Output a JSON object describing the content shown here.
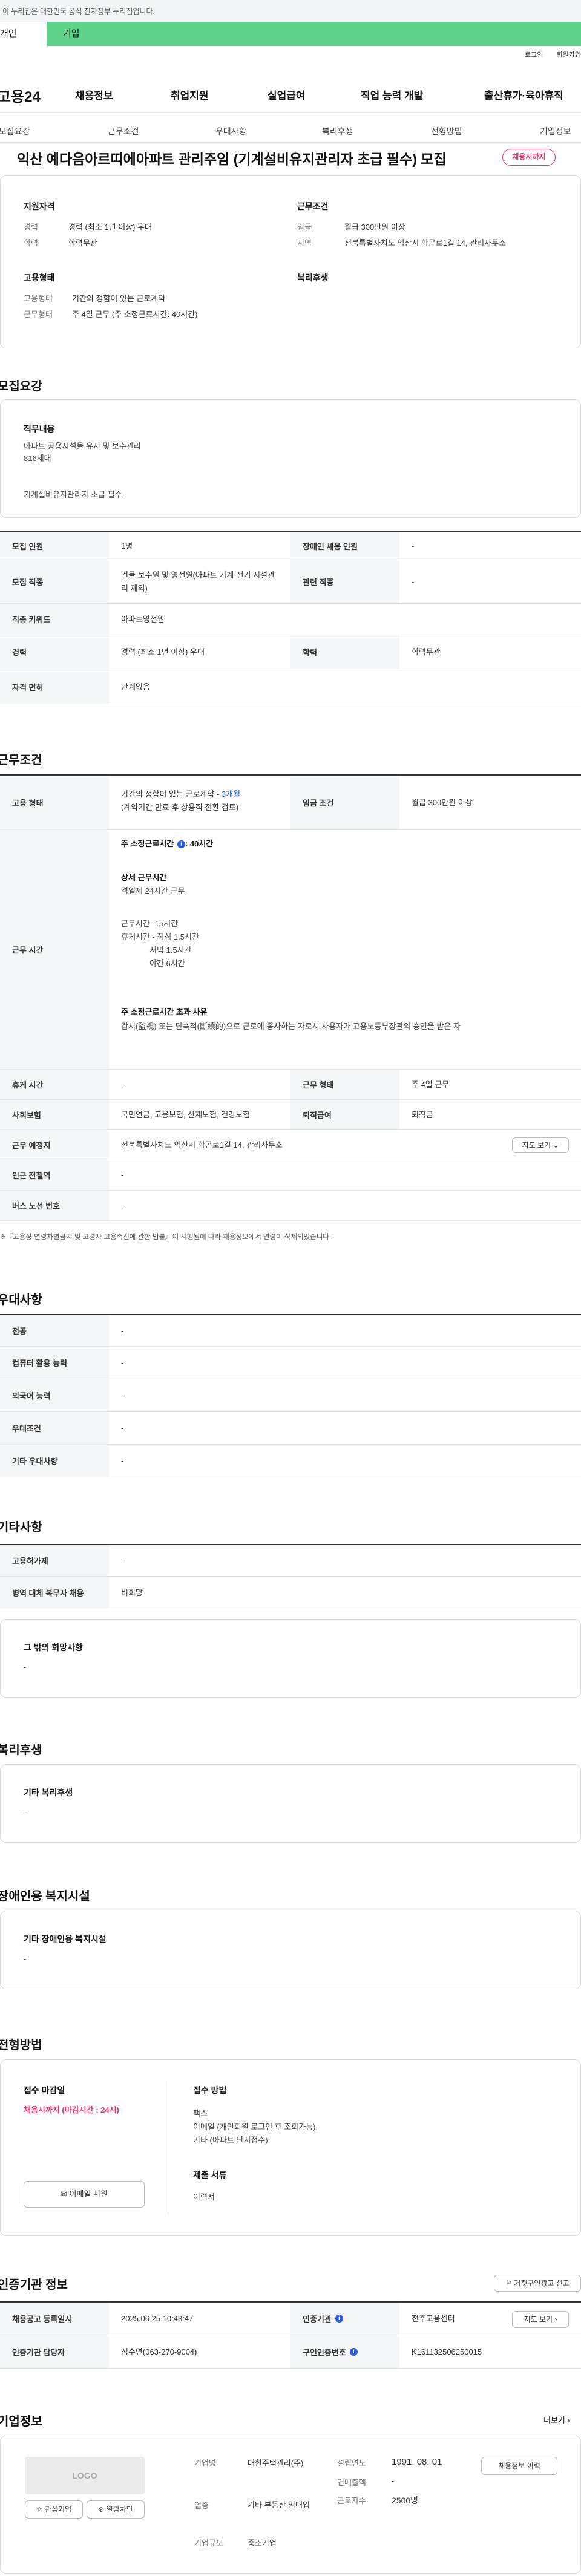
{
  "gov_banner": "이 누리집은 대한민국 공식 전자정부 누리집입니다.",
  "user_tabs": [
    "개인",
    "기업"
  ],
  "util_links": [
    "로그인",
    "회원가입"
  ],
  "site_logo": "고용24",
  "gnb": [
    "채용정보",
    "취업지원",
    "실업급여",
    "직업 능력 개발",
    "출산휴가·육아휴직"
  ],
  "snb": [
    "모집요강",
    "근무조건",
    "우대사항",
    "복리후생",
    "전형방법",
    "기업정보"
  ],
  "title": "익산 예다음아르띠에아파트 관리주임 (기계설비유지관리자 초급 필수) 모집",
  "status_badge": "채용시까지",
  "summary": {
    "left_head": "지원자격",
    "left": [
      {
        "k": "경력",
        "v": "경력 (최소 1년 이상) 우대"
      },
      {
        "k": "학력",
        "v": "학력무관"
      }
    ],
    "right_head": "근무조건",
    "right": [
      {
        "k": "임금",
        "v": "월급 300만원 이상"
      },
      {
        "k": "지역",
        "v": "전북특별자치도 익산시 학곤로1길 14, 관리사무소"
      }
    ],
    "emp_head": "고용형태",
    "emp": [
      {
        "k": "고용형태",
        "v": "기간의 정함이 있는 근로계약"
      },
      {
        "k": "근무형태",
        "v": "주 4일 근무 (주 소정근로시간: 40시간)"
      }
    ],
    "welfare_head": "복리후생"
  },
  "recruit": {
    "section": "모집요강",
    "duty_head": "직무내용",
    "duty_lines": [
      "아파트 공용시설물 유지 및 보수관리",
      "816세대",
      "",
      "기계설비유지관리자 초급 필수"
    ],
    "rows": [
      {
        "h1": "모집 인원",
        "v1": "1명",
        "h2": "장애인 채용 인원",
        "v2": "-"
      },
      {
        "h1": "모집 직종",
        "v1": "건물 보수원 및 영선원(아파트 기계·전기 시설관리 제외)",
        "h2": "관련 직종",
        "v2": "-"
      },
      {
        "h1": "직종 키워드",
        "v1": "아파트영선원"
      },
      {
        "h1": "경력",
        "v1": "경력 (최소 1년 이상) 우대",
        "h2": "학력",
        "v2": "학력무관"
      },
      {
        "h1": "자격 면허",
        "v1": "관계없음"
      }
    ]
  },
  "work": {
    "section": "근무조건",
    "emp_h": "고용 형태",
    "emp_v1": "기간의 정함이 있는 근로계약 - ",
    "emp_v_link": "3개월",
    "emp_v2": "(계약기간 만료 후 상용직 전환 검토)",
    "wage_h": "임금 조건",
    "wage_v": "월급 300만원 이상",
    "hours_h": "근무 시간",
    "hours_weekly": "주 소정근로시간",
    "hours_weekly_v": ": 40시간",
    "detail_head": "상세 근무시간",
    "detail_lines": [
      "격일제 24시간 근무",
      "",
      "근무시간- 15시간",
      "휴게시간 - 점심 1.5시간",
      "             저녁 1.5시간",
      "             야간 6시간"
    ],
    "over_head": "주 소정근로시간 초과 사유",
    "over_text": "감시(監視) 또는 단속적(斷續的)으로 근로에 종사하는 자로서 사용자가 고용노동부장관의 승인을 받은 자",
    "break_h": "휴게 시간",
    "break_v": "-",
    "form_h": "근무 형태",
    "form_v": "주 4일 근무",
    "ins_h": "사회보험",
    "ins_v": "국민연금, 고용보험, 산재보험, 건강보험",
    "ret_h": "퇴직급여",
    "ret_v": "퇴직금",
    "loc_h": "근무 예정지",
    "loc_v": "전북특별자치도 익산시 학곤로1길 14, 관리사무소",
    "map_btn": "지도 보기",
    "sub_h": "인근 전철역",
    "sub_v": "-",
    "bus_h": "버스 노선 번호",
    "bus_v": "-",
    "note": "※『고용상 연령차별금지 및 고령자 고용촉진에 관한 법률』이 시행됨에 따라 채용정보에서 연령이 삭제되었습니다."
  },
  "pref": {
    "section": "우대사항",
    "rows": [
      {
        "h": "전공",
        "v": "-"
      },
      {
        "h": "컴퓨터 활용 능력",
        "v": "-"
      },
      {
        "h": "외국어 능력",
        "v": "-"
      },
      {
        "h": "우대조건",
        "v": "-"
      },
      {
        "h": "기타 우대사항",
        "v": "-"
      }
    ]
  },
  "etc": {
    "section": "기타사항",
    "rows": [
      {
        "h": "고용허가제",
        "v": "-"
      },
      {
        "h": "병역 대체 복무자 채용",
        "v": "비희망"
      }
    ],
    "other_head": "그 밖의 희망사항",
    "other_v": "-"
  },
  "welfare": {
    "section": "복리후생",
    "head": "기타 복리후생",
    "v": "-"
  },
  "disab": {
    "section": "장애인용 복지시설",
    "head": "기타 장애인용 복지시설",
    "v": "-"
  },
  "process": {
    "section": "전형방법",
    "deadline_head": "접수 마감일",
    "deadline_v": "채용시까지 (마감시간 : 24시)",
    "email_btn": "이메일 지원",
    "method_head": "접수 방법",
    "method_lines": [
      "팩스",
      "이메일 (개인회원 로그인 후 조회가능),",
      "기타 (아파트 단지접수)"
    ],
    "docs_head": "제출 서류",
    "docs_v": "이력서"
  },
  "cert": {
    "section": "인증기관 정보",
    "report_btn": "거짓구인광고 신고",
    "reg_h": "채용공고 등록일시",
    "reg_v": "2025.06.25 10:43:47",
    "org_h": "인증기관",
    "org_v": "전주고용센터",
    "org_btn": "지도 보기",
    "mgr_h": "인증기관 담당자",
    "mgr_v": "정수연(063-270-9004)",
    "num_h": "구인인증번호",
    "num_v": "K161132506250015"
  },
  "company": {
    "section": "기업정보",
    "more": "더보기",
    "logo_text": "LOGO",
    "fav_btn": "관심기업",
    "block_btn": "열람차단",
    "name_k": "기업명",
    "name_v": "대한주택관리(주)",
    "ind_k": "업종",
    "ind_v": "기타 부동산 임대업",
    "scale_k": "기업규모",
    "scale_v": "중소기업",
    "est_k": "설립연도",
    "est_v": "1991. 08. 01",
    "sales_k": "연매출액",
    "sales_v": "-",
    "emp_k": "근로자수",
    "emp_v": "2500명",
    "hist_btn": "채용정보 이력"
  }
}
